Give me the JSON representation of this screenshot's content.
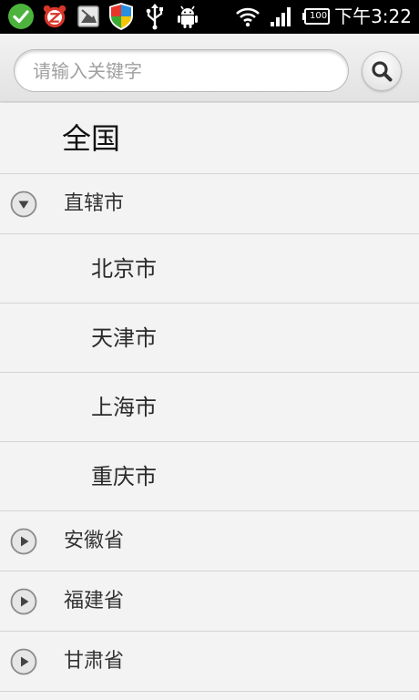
{
  "status_bar": {
    "time": "下午3:22",
    "icons": [
      "check-icon",
      "alarm-clock-icon",
      "gallery-icon",
      "shield-icon",
      "usb-icon",
      "android-icon",
      "wifi-icon",
      "signal-icon",
      "battery-icon"
    ],
    "battery_level": "100"
  },
  "search": {
    "placeholder": "请输入关键字",
    "button_icon": "search-icon"
  },
  "list": {
    "national": "全国",
    "groups": [
      {
        "label": "直辖市",
        "expanded": true,
        "cities": [
          "北京市",
          "天津市",
          "上海市",
          "重庆市"
        ]
      },
      {
        "label": "安徽省",
        "expanded": false
      },
      {
        "label": "福建省",
        "expanded": false
      },
      {
        "label": "甘肃省",
        "expanded": false
      }
    ]
  },
  "colors": {
    "status_bar_bg": "#000000",
    "list_bg": "#f3f3f3",
    "divider": "#d4d4d4",
    "check_green": "#4db33d",
    "alarm_red": "#d9362a"
  }
}
